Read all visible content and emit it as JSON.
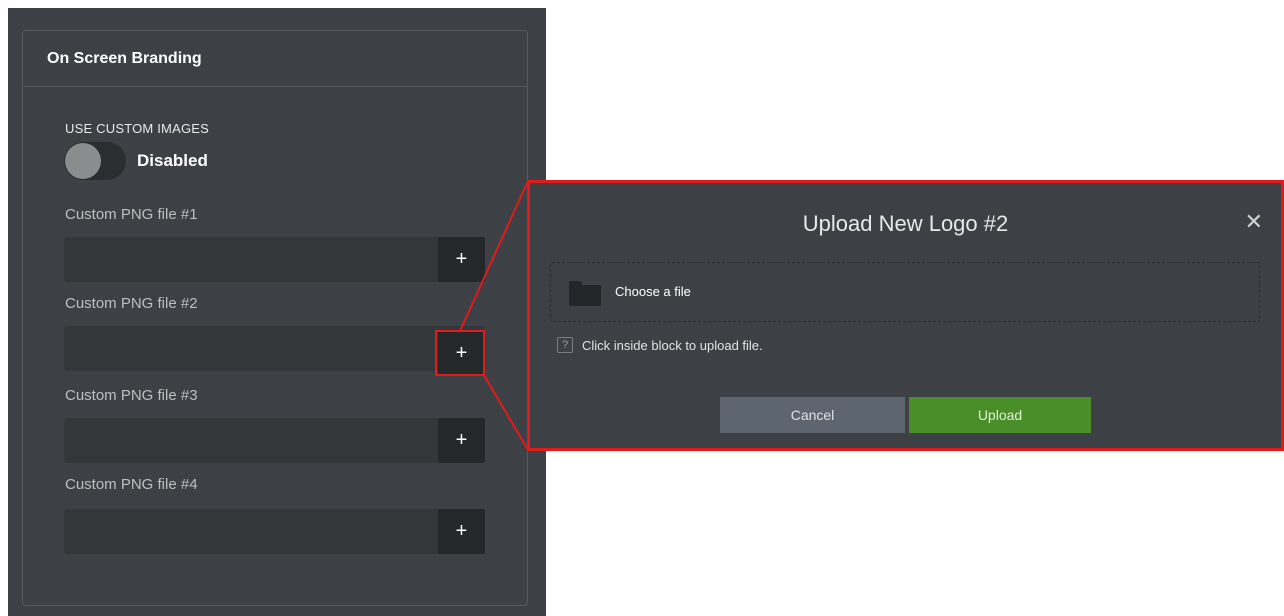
{
  "branding_panel": {
    "title": "On Screen Branding",
    "custom_images_label": "USE CUSTOM IMAGES",
    "toggle_state": "Disabled",
    "toggle_enabled": false,
    "files": [
      {
        "label": "Custom PNG file #1",
        "value": "",
        "button": "+"
      },
      {
        "label": "Custom PNG file #2",
        "value": "",
        "button": "+"
      },
      {
        "label": "Custom PNG file #3",
        "value": "",
        "button": "+"
      },
      {
        "label": "Custom PNG file #4",
        "value": "",
        "button": "+"
      }
    ]
  },
  "upload_modal": {
    "title": "Upload New Logo #2",
    "close_icon": "close-icon",
    "drop_zone_text": "Choose a file",
    "help_icon_glyph": "?",
    "help_text": "Click inside block to upload file.",
    "cancel_label": "Cancel",
    "upload_label": "Upload"
  },
  "colors": {
    "highlight": "#e21a1a",
    "upload_button": "#4a8e2a",
    "cancel_button": "#5d666e",
    "panel_background": "#3d4145"
  }
}
